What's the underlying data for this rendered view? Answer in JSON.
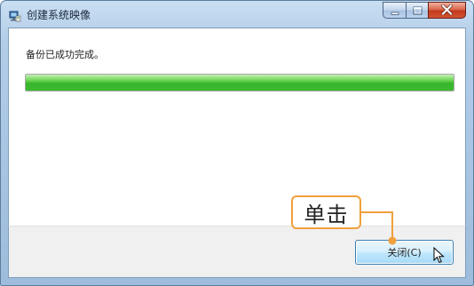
{
  "window": {
    "title": "创建系统映像",
    "icon": "system-image-icon"
  },
  "caption_buttons": {
    "minimize_icon": "minimize-icon",
    "maximize_icon": "maximize-icon",
    "close_icon": "close-icon",
    "close_color": "#c23a1c"
  },
  "main": {
    "status_text": "备份已成功完成。",
    "progress": {
      "value": 1.0,
      "color": "#37b52a"
    }
  },
  "footer": {
    "close_button_label": "关闭(C)"
  },
  "annotation": {
    "label": "单击",
    "color": "#f0a03c"
  }
}
